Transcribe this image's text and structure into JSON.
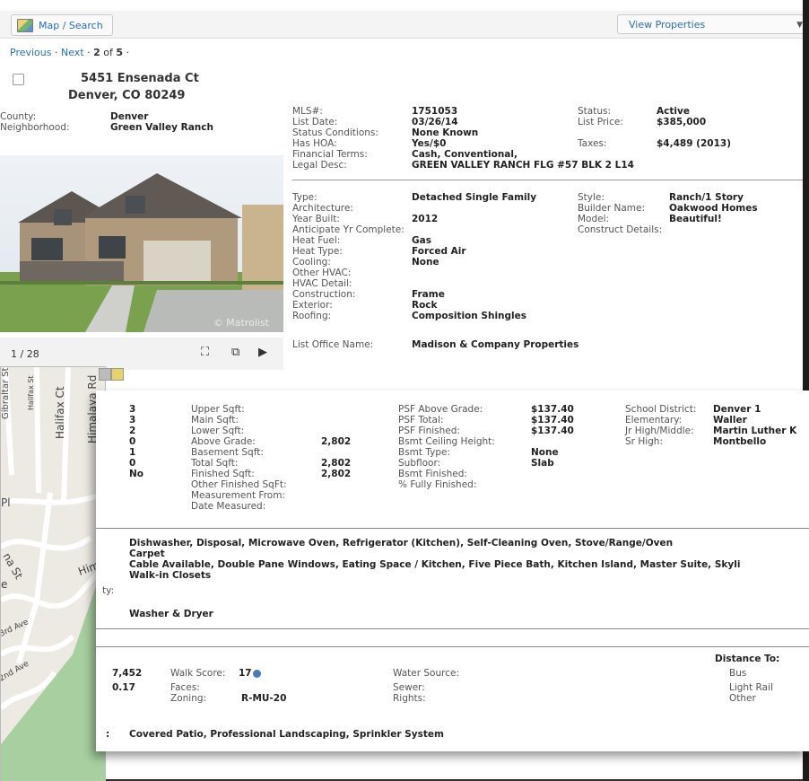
{
  "toolbar": {
    "map_search": "Map / Search",
    "view_properties": "View Properties"
  },
  "pager": {
    "prev": "Previous",
    "sep1": " · ",
    "next": "Next",
    "sep2": " · ",
    "current": "2",
    "of": " of ",
    "total": "5",
    "tail": " ·"
  },
  "listing": {
    "address_line1": "5451 Ensenada Ct",
    "address_line2": "Denver, CO 80249",
    "county_label": "County:",
    "county": "Denver",
    "neighborhood_label": "Neighborhood:",
    "neighborhood": "Green Valley Ranch",
    "mls_label": "MLS#:",
    "mls": "1751053",
    "list_date_label": "List Date:",
    "list_date": "03/26/14",
    "status_cond_label": "Status Conditions:",
    "status_cond": "None Known",
    "hoa_label": "Has HOA:",
    "hoa": "Yes/$0",
    "fin_terms_label": "Financial Terms:",
    "fin_terms": "Cash, Conventional,",
    "legal_label": "Legal Desc:",
    "legal": "GREEN VALLEY RANCH FLG #57 BLK 2 L14",
    "status_label": "Status:",
    "status": "Active",
    "price_label": "List Price:",
    "price": "$385,000",
    "taxes_label": "Taxes:",
    "taxes": "$4,489 (2013)",
    "type_label": "Type:",
    "type": "Detached Single Family",
    "arch_label": "Architecture:",
    "year_label": "Year Built:",
    "year": "2012",
    "anticipate_label": "Anticipate Yr Complete:",
    "heat_fuel_label": "Heat Fuel:",
    "heat_fuel": "Gas",
    "heat_type_label": "Heat Type:",
    "heat_type": "Forced Air",
    "cooling_label": "Cooling:",
    "cooling": "None",
    "other_hvac_label": "Other HVAC:",
    "hvac_detail_label": "HVAC Detail:",
    "construction_label": "Construction:",
    "construction": "Frame",
    "exterior_label": "Exterior:",
    "exterior": "Rock",
    "roofing_label": "Roofing:",
    "roofing": "Composition Shingles",
    "style_label": "Style:",
    "style": "Ranch/1 Story",
    "builder_label": "Builder Name:",
    "builder": "Oakwood Homes",
    "model_label": "Model:",
    "model": "Beautiful!",
    "construct_details_label": "Construct Details:",
    "office_label": "List Office Name:",
    "office": "Madison & Company Properties",
    "photo_count": "1 / 28",
    "watermark": "© Matrolist"
  },
  "rooms": {
    "col1": [
      "3",
      "3",
      "2",
      "0",
      "1",
      "0",
      "No"
    ],
    "labels": [
      "Upper Sqft:",
      "Main Sqft:",
      "Lower Sqft:",
      "Above Grade:",
      "Basement Sqft:",
      "Total Sqft:",
      "Finished Sqft:",
      "Other Finished SqFt:",
      "Measurement From:",
      "Date Measured:"
    ],
    "values": {
      "above_grade": "2,802",
      "total": "2,802",
      "finished": "2,802"
    },
    "psf_labels": [
      "PSF Above Grade:",
      "PSF Total:",
      "PSF Finished:",
      "Bsmt Ceiling Height:",
      "Bsmt Type:",
      "Subfloor:",
      "Bsmt Finished:",
      "% Fully Finished:"
    ],
    "psf_values": [
      "$137.40",
      "$137.40",
      "$137.40",
      "",
      "None",
      "Slab",
      "",
      ""
    ],
    "school_labels": [
      "School District:",
      "Elementary:",
      "Jr High/Middle:",
      "Sr High:"
    ],
    "school_values": [
      "Denver 1",
      "Waller",
      "Martin Luther K",
      "Montbello"
    ]
  },
  "features": {
    "appliances": "Dishwasher, Disposal, Microwave Oven, Refrigerator (Kitchen), Self-Cleaning Oven, Stove/Range/Oven",
    "flooring": "Carpet",
    "interior": "Cable Available, Double Pane Windows, Eating Space / Kitchen, Five Piece Bath, Kitchen Island, Master Suite, Skyli",
    "closets": "Walk-in Closets",
    "laundry_partial_label": "ty:",
    "laundry": "Washer & Dryer"
  },
  "lot": {
    "lot_sqft": "7,452",
    "acres": "0.17",
    "walk_label": "Walk Score:",
    "walk": "17",
    "faces_label": "Faces:",
    "zoning_label": "Zoning:",
    "zoning": "R-MU-20",
    "water_label": "Water Source:",
    "sewer_label": "Sewer:",
    "rights_label": "Rights:",
    "distance_label": "Distance To:",
    "bus": "Bus",
    "light_rail": "Light Rail",
    "other": "Other",
    "exterior_features_partial": ":",
    "exterior_features": "Covered Patio, Professional Landscaping, Sprinkler System"
  },
  "map": {
    "streets": [
      "Gibraltar St",
      "Halifax St",
      "Halifax Ct",
      "Himalaya Rd",
      "Pl",
      "na St",
      "Him",
      "e",
      "3rd Ave",
      "2nd Ave"
    ]
  },
  "colors": {
    "link": "#2a6fb4",
    "frame": "#3f3a33"
  }
}
